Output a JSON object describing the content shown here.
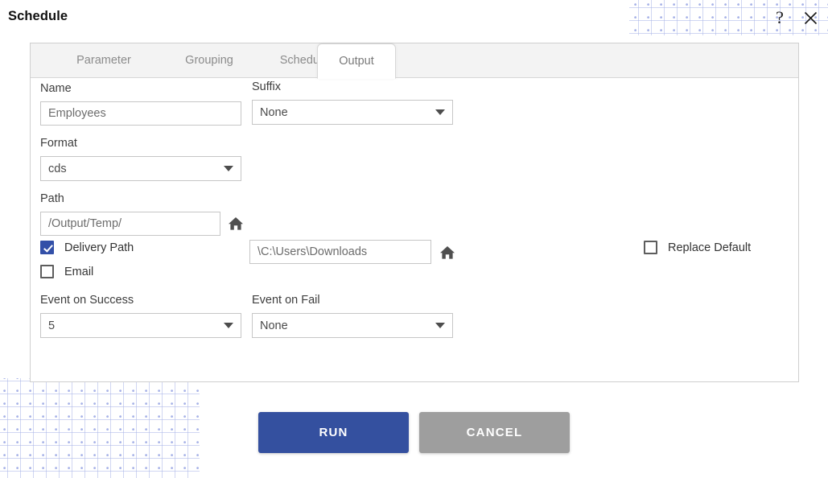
{
  "header": {
    "title": "Schedule",
    "help_icon": "question-mark-icon",
    "help_glyph": "?",
    "close_icon": "close-icon"
  },
  "tabs": [
    {
      "id": "parameter",
      "label": "Parameter",
      "active": false
    },
    {
      "id": "grouping",
      "label": "Grouping",
      "active": false
    },
    {
      "id": "schedule",
      "label": "Schedule",
      "active": false
    },
    {
      "id": "output",
      "label": "Output",
      "active": true
    }
  ],
  "form": {
    "name": {
      "label": "Name",
      "value": "Employees",
      "placeholder": "Employees"
    },
    "suffix": {
      "label": "Suffix",
      "value": "None",
      "options": [
        "None"
      ]
    },
    "format": {
      "label": "Format",
      "value": "cds",
      "options": [
        "cds"
      ]
    },
    "path": {
      "label": "Path",
      "value": "/Output/Temp/",
      "placeholder": "/Output/Temp/",
      "home_icon": "home-icon"
    },
    "delivery_path": {
      "label": "Delivery Path",
      "checked": true,
      "value": "\\C:\\Users\\Downloads",
      "placeholder": "\\C:\\Users\\Downloads",
      "home_icon": "home-icon"
    },
    "email": {
      "label": "Email",
      "checked": false
    },
    "replace_default": {
      "label": "Replace Default",
      "checked": false
    },
    "event_on_success": {
      "label": "Event on Success",
      "value": "5",
      "options": [
        "5"
      ]
    },
    "event_on_fail": {
      "label": "Event on Fail",
      "value": "None",
      "options": [
        "None"
      ]
    }
  },
  "footer": {
    "run_label": "RUN",
    "cancel_label": "CANCEL"
  },
  "colors": {
    "primary_blue": "#34509f",
    "checkbox_blue": "#3350a8",
    "cancel_gray": "#9e9e9e",
    "pattern_dot": "#a9b4e8",
    "tabstrip_gray": "#f3f3f3"
  }
}
